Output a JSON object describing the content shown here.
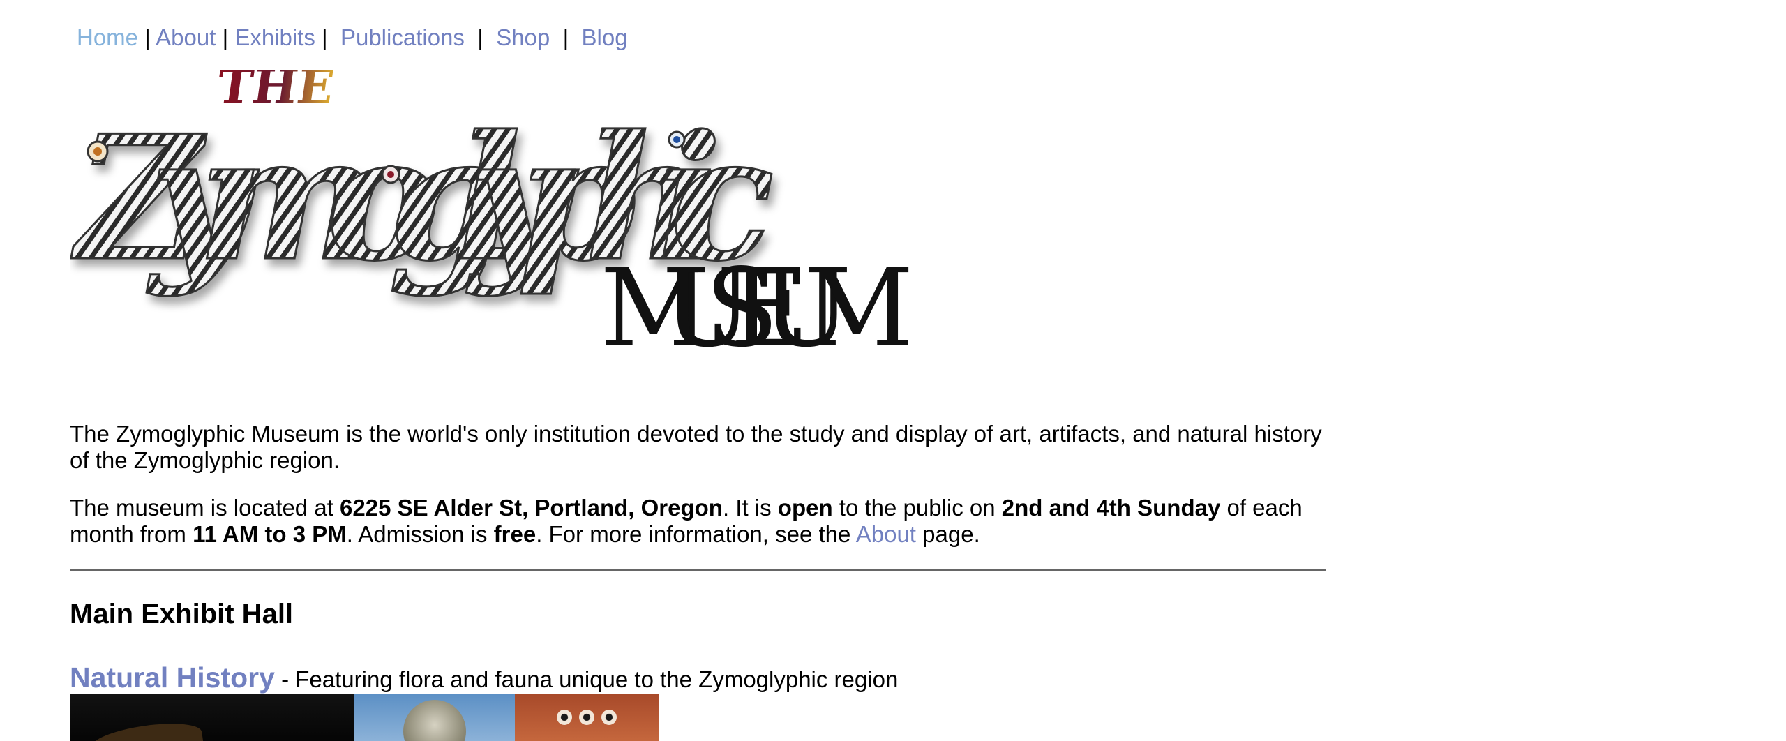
{
  "nav": {
    "items": [
      {
        "label": "Home",
        "current": true
      },
      {
        "label": "About"
      },
      {
        "label": "Exhibits"
      },
      {
        "label": "Publications"
      },
      {
        "label": "Shop"
      },
      {
        "label": "Blog"
      }
    ],
    "separator": "|",
    "colors": {
      "link": "#7180c0",
      "current": "#86b3dc"
    }
  },
  "logo": {
    "the": "THE",
    "name": "Zymoglyphic",
    "subtitle": "MUSEUM"
  },
  "intro": {
    "p1": "The Zymoglyphic Museum is the world's only institution devoted to the study and display of art, artifacts, and natural history of the Zymoglyphic region.",
    "p2_a": "The museum is located at ",
    "address": "6225 SE Alder St, Portland, Oregon",
    "p2_b": ". It is ",
    "open": "open",
    "p2_c": " to the public on ",
    "days": "2nd and 4th Sunday",
    "p2_d": " of each month from ",
    "hours": "11 AM to 3 PM",
    "p2_e": ". Admission is ",
    "admission": "free",
    "p2_f": ". For more information, see the ",
    "about_link": "About",
    "p2_g": " page."
  },
  "hall": {
    "title": "Main Exhibit Hall",
    "exhibits": [
      {
        "title": "Natural History",
        "description": " - Featuring flora and fauna unique to the Zymoglyphic region"
      }
    ]
  }
}
